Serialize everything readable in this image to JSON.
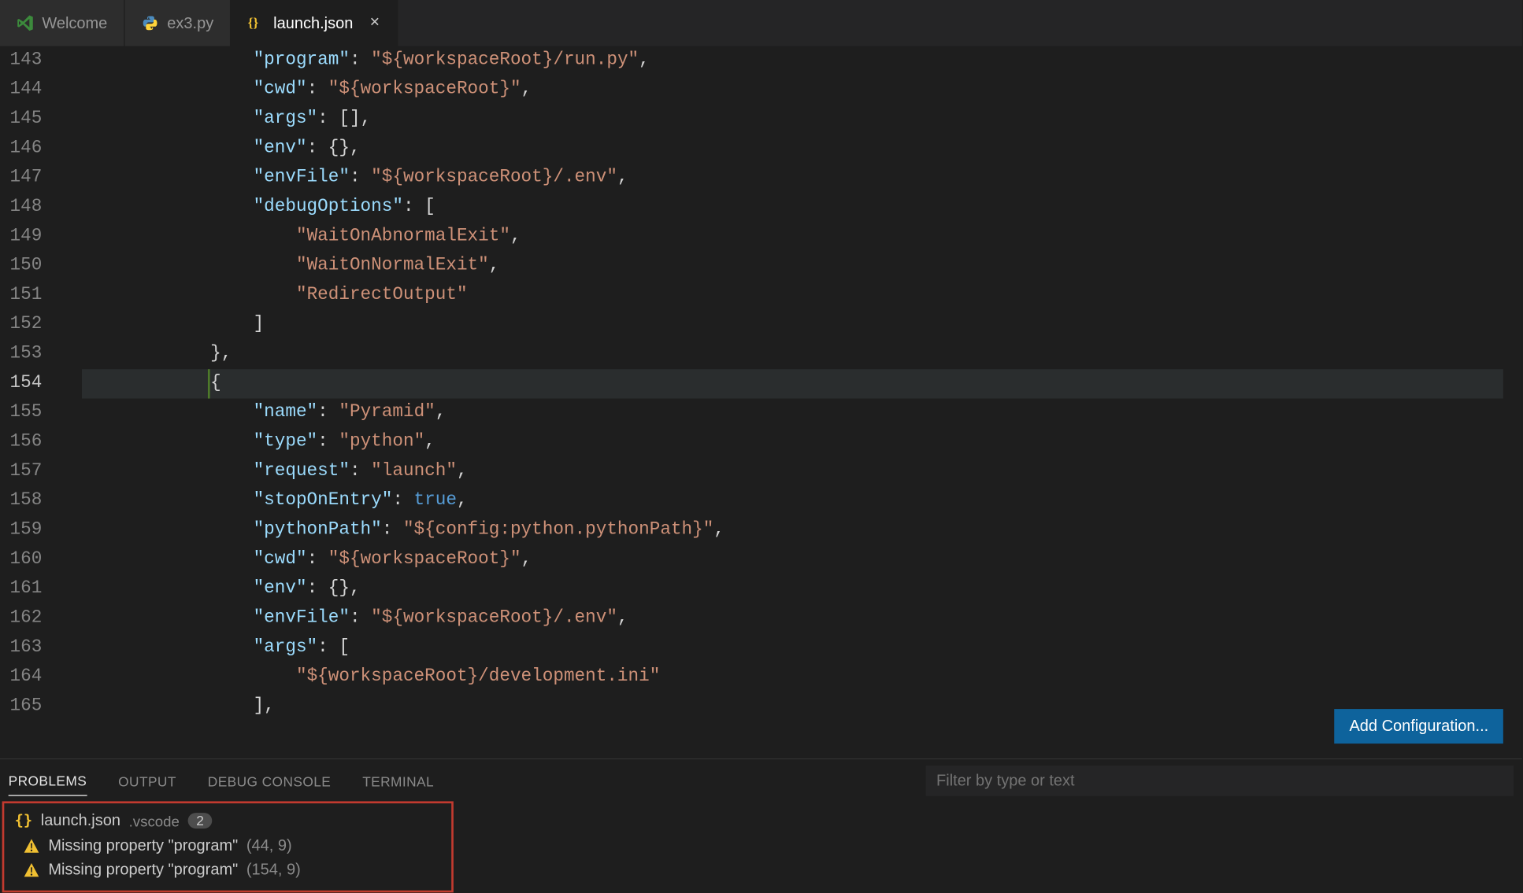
{
  "tabs": [
    {
      "label": "Welcome",
      "icon": "vscode"
    },
    {
      "label": "ex3.py",
      "icon": "python"
    },
    {
      "label": "launch.json",
      "icon": "json",
      "active": true,
      "closable": true
    }
  ],
  "editor": {
    "startLine": 143,
    "highlightLine": 154,
    "addConfigLabel": "Add Configuration...",
    "lines": [
      {
        "n": 143,
        "indent": 4,
        "t": [
          [
            "key",
            "\"program\""
          ],
          [
            "punc",
            ": "
          ],
          [
            "str",
            "\"${workspaceRoot}/run.py\""
          ],
          [
            "punc",
            ","
          ]
        ]
      },
      {
        "n": 144,
        "indent": 4,
        "t": [
          [
            "key",
            "\"cwd\""
          ],
          [
            "punc",
            ": "
          ],
          [
            "str",
            "\"${workspaceRoot}\""
          ],
          [
            "punc",
            ","
          ]
        ]
      },
      {
        "n": 145,
        "indent": 4,
        "t": [
          [
            "key",
            "\"args\""
          ],
          [
            "punc",
            ": [],"
          ]
        ]
      },
      {
        "n": 146,
        "indent": 4,
        "t": [
          [
            "key",
            "\"env\""
          ],
          [
            "punc",
            ": {},"
          ]
        ]
      },
      {
        "n": 147,
        "indent": 4,
        "t": [
          [
            "key",
            "\"envFile\""
          ],
          [
            "punc",
            ": "
          ],
          [
            "str",
            "\"${workspaceRoot}/.env\""
          ],
          [
            "punc",
            ","
          ]
        ]
      },
      {
        "n": 148,
        "indent": 4,
        "t": [
          [
            "key",
            "\"debugOptions\""
          ],
          [
            "punc",
            ": ["
          ]
        ]
      },
      {
        "n": 149,
        "indent": 5,
        "t": [
          [
            "str",
            "\"WaitOnAbnormalExit\""
          ],
          [
            "punc",
            ","
          ]
        ]
      },
      {
        "n": 150,
        "indent": 5,
        "t": [
          [
            "str",
            "\"WaitOnNormalExit\""
          ],
          [
            "punc",
            ","
          ]
        ]
      },
      {
        "n": 151,
        "indent": 5,
        "t": [
          [
            "str",
            "\"RedirectOutput\""
          ]
        ]
      },
      {
        "n": 152,
        "indent": 4,
        "t": [
          [
            "punc",
            "]"
          ]
        ]
      },
      {
        "n": 153,
        "indent": 3,
        "t": [
          [
            "punc",
            "},"
          ]
        ]
      },
      {
        "n": 154,
        "indent": 3,
        "t": [
          [
            "punc",
            "{"
          ]
        ],
        "hl": true
      },
      {
        "n": 155,
        "indent": 4,
        "t": [
          [
            "key",
            "\"name\""
          ],
          [
            "punc",
            ": "
          ],
          [
            "str",
            "\"Pyramid\""
          ],
          [
            "punc",
            ","
          ]
        ]
      },
      {
        "n": 156,
        "indent": 4,
        "t": [
          [
            "key",
            "\"type\""
          ],
          [
            "punc",
            ": "
          ],
          [
            "str",
            "\"python\""
          ],
          [
            "punc",
            ","
          ]
        ]
      },
      {
        "n": 157,
        "indent": 4,
        "t": [
          [
            "key",
            "\"request\""
          ],
          [
            "punc",
            ": "
          ],
          [
            "str",
            "\"launch\""
          ],
          [
            "punc",
            ","
          ]
        ]
      },
      {
        "n": 158,
        "indent": 4,
        "t": [
          [
            "key",
            "\"stopOnEntry\""
          ],
          [
            "punc",
            ": "
          ],
          [
            "bool",
            "true"
          ],
          [
            "punc",
            ","
          ]
        ]
      },
      {
        "n": 159,
        "indent": 4,
        "t": [
          [
            "key",
            "\"pythonPath\""
          ],
          [
            "punc",
            ": "
          ],
          [
            "str",
            "\"${config:python.pythonPath}\""
          ],
          [
            "punc",
            ","
          ]
        ]
      },
      {
        "n": 160,
        "indent": 4,
        "t": [
          [
            "key",
            "\"cwd\""
          ],
          [
            "punc",
            ": "
          ],
          [
            "str",
            "\"${workspaceRoot}\""
          ],
          [
            "punc",
            ","
          ]
        ]
      },
      {
        "n": 161,
        "indent": 4,
        "t": [
          [
            "key",
            "\"env\""
          ],
          [
            "punc",
            ": {},"
          ]
        ]
      },
      {
        "n": 162,
        "indent": 4,
        "t": [
          [
            "key",
            "\"envFile\""
          ],
          [
            "punc",
            ": "
          ],
          [
            "str",
            "\"${workspaceRoot}/.env\""
          ],
          [
            "punc",
            ","
          ]
        ]
      },
      {
        "n": 163,
        "indent": 4,
        "t": [
          [
            "key",
            "\"args\""
          ],
          [
            "punc",
            ": ["
          ]
        ]
      },
      {
        "n": 164,
        "indent": 5,
        "t": [
          [
            "str",
            "\"${workspaceRoot}/development.ini\""
          ]
        ]
      },
      {
        "n": 165,
        "indent": 4,
        "t": [
          [
            "punc",
            "],"
          ]
        ]
      }
    ]
  },
  "panel": {
    "tabs": [
      "PROBLEMS",
      "OUTPUT",
      "DEBUG CONSOLE",
      "TERMINAL"
    ],
    "activeTab": 0,
    "filterPlaceholder": "Filter by type or text",
    "group": {
      "file": "launch.json",
      "folder": ".vscode",
      "count": "2"
    },
    "problems": [
      {
        "msg": "Missing property \"program\"",
        "loc": "(44, 9)"
      },
      {
        "msg": "Missing property \"program\"",
        "loc": "(154, 9)"
      }
    ]
  }
}
